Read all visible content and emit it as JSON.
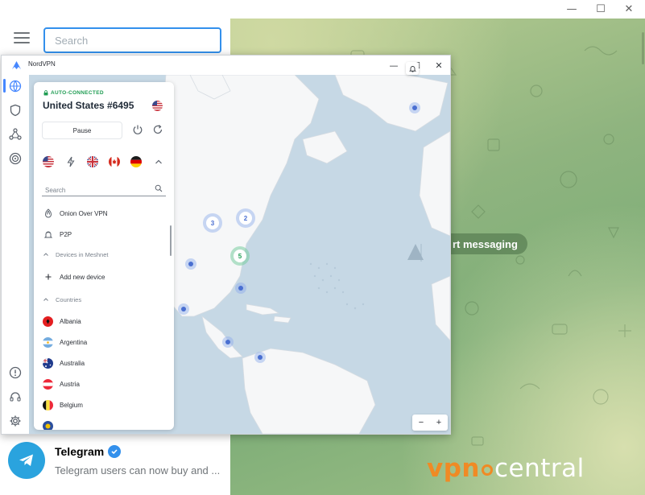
{
  "telegram": {
    "window_controls": [
      "—",
      "☐",
      "✕"
    ],
    "search": {
      "placeholder": "Search",
      "value": ""
    },
    "start_messaging": "rt messaging",
    "chat": {
      "name": "Telegram",
      "preview": "Telegram users can now buy and ..."
    }
  },
  "nordvpn": {
    "title": "NordVPN",
    "window_controls": [
      "—",
      "☐",
      "✕"
    ],
    "status": "AUTO-CONNECTED",
    "server": "United States #6495",
    "pause_label": "Pause",
    "search_placeholder": "Search",
    "specialty": [
      {
        "label": "Onion Over VPN",
        "icon": "onion-icon"
      },
      {
        "label": "P2P",
        "icon": "p2p-icon"
      }
    ],
    "meshnet_label": "Devices in Meshnet",
    "add_device_label": "Add new device",
    "countries_label": "Countries",
    "countries": [
      "Albania",
      "Argentina",
      "Australia",
      "Austria",
      "Belgium"
    ],
    "map_clusters": [
      "3",
      "2",
      "5"
    ],
    "zoom": {
      "minus": "−",
      "plus": "+"
    }
  },
  "watermark": {
    "left": "vpn",
    "right": "central"
  },
  "colors": {
    "telegram_accent": "#3390ec",
    "nord_accent": "#4687ff",
    "connected_green": "#1e9c52",
    "map_water": "#c6d8e5",
    "map_land": "#f5f6f7",
    "watermark_orange": "#f08a24"
  }
}
